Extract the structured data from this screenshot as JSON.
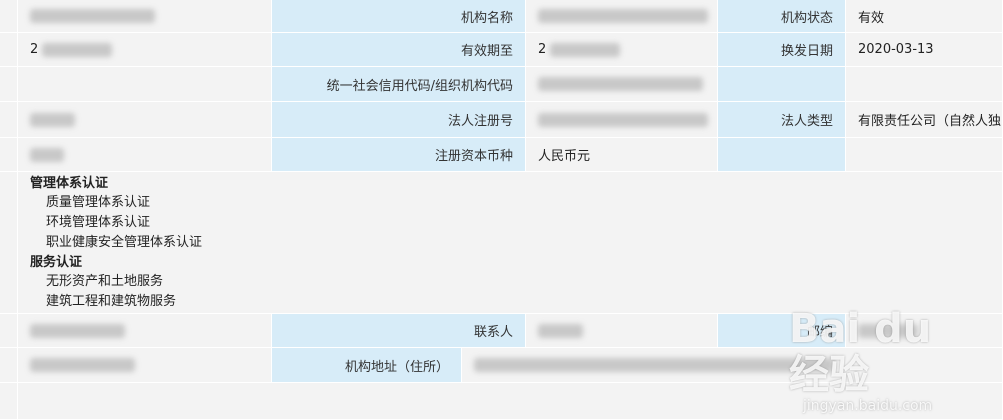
{
  "row1": {
    "label_org_name": "机构名称",
    "label_org_status": "机构状态",
    "org_status": "有效"
  },
  "row2": {
    "left_prefix": "2",
    "label_valid_until": "有效期至",
    "valid_prefix": "2",
    "label_renew_date": "换发日期",
    "renew_date": "2020-03-13"
  },
  "row3": {
    "label_credit_code": "统一社会信用代码/组织机构代码"
  },
  "row4": {
    "label_legal_reg_no": "法人注册号",
    "label_legal_type": "法人类型",
    "legal_type": "有限责任公司（自然人独"
  },
  "row5": {
    "label_capital_currency": "注册资本币种",
    "capital_currency": "人民币元"
  },
  "certs": {
    "group1_title": "管理体系认证",
    "group1_items": [
      "质量管理体系认证",
      "环境管理体系认证",
      "职业健康安全管理体系认证"
    ],
    "group2_title": "服务认证",
    "group2_items": [
      "无形资产和土地服务",
      "建筑工程和建筑物服务"
    ]
  },
  "row7": {
    "label_contact": "联系人",
    "label_postcode": "邮编"
  },
  "row8": {
    "label_address": "机构地址（住所）"
  },
  "watermark": {
    "logo": "Bai du 经验",
    "url": "jingyan.baidu.com"
  }
}
